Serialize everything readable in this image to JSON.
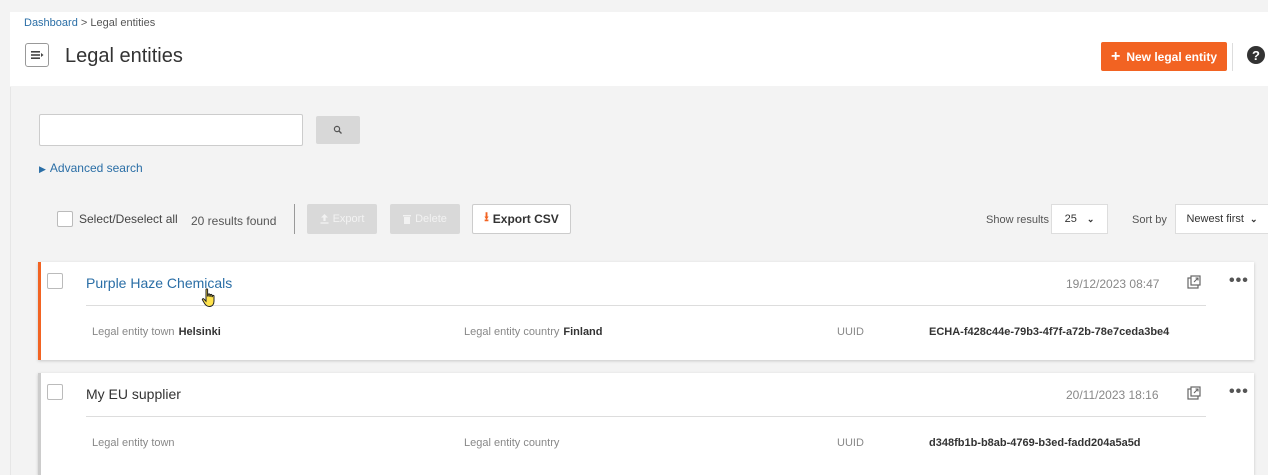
{
  "breadcrumb": {
    "link": "Dashboard",
    "separator": " > ",
    "current": "Legal entities"
  },
  "header": {
    "title": "Legal entities",
    "new_button": "New legal entity",
    "help": "?"
  },
  "search": {
    "value": "",
    "placeholder": ""
  },
  "advanced_search": "Advanced search",
  "toolbar": {
    "select_all": "Select/Deselect all",
    "results_found": "20 results found",
    "export": "Export",
    "delete": "Delete",
    "export_csv": "Export CSV",
    "show_results_label": "Show results",
    "show_results_value": "25",
    "sort_by_label": "Sort by",
    "sort_by_value": "Newest first"
  },
  "colors": {
    "accent": "#f26322",
    "link": "#2a6ea6"
  },
  "entities": [
    {
      "name": "Purple Haze Chemicals",
      "date": "19/12/2023 08:47",
      "town_label": "Legal entity town",
      "town": "Helsinki",
      "country_label": "Legal entity country",
      "country": "Finland",
      "uuid_label": "UUID",
      "uuid": "ECHA-f428c44e-79b3-4f7f-a72b-78e7ceda3be4"
    },
    {
      "name": "My EU supplier",
      "date": "20/11/2023 18:16",
      "town_label": "Legal entity town",
      "town": "",
      "country_label": "Legal entity country",
      "country": "",
      "uuid_label": "UUID",
      "uuid": "d348fb1b-b8ab-4769-b3ed-fadd204a5a5d"
    }
  ]
}
